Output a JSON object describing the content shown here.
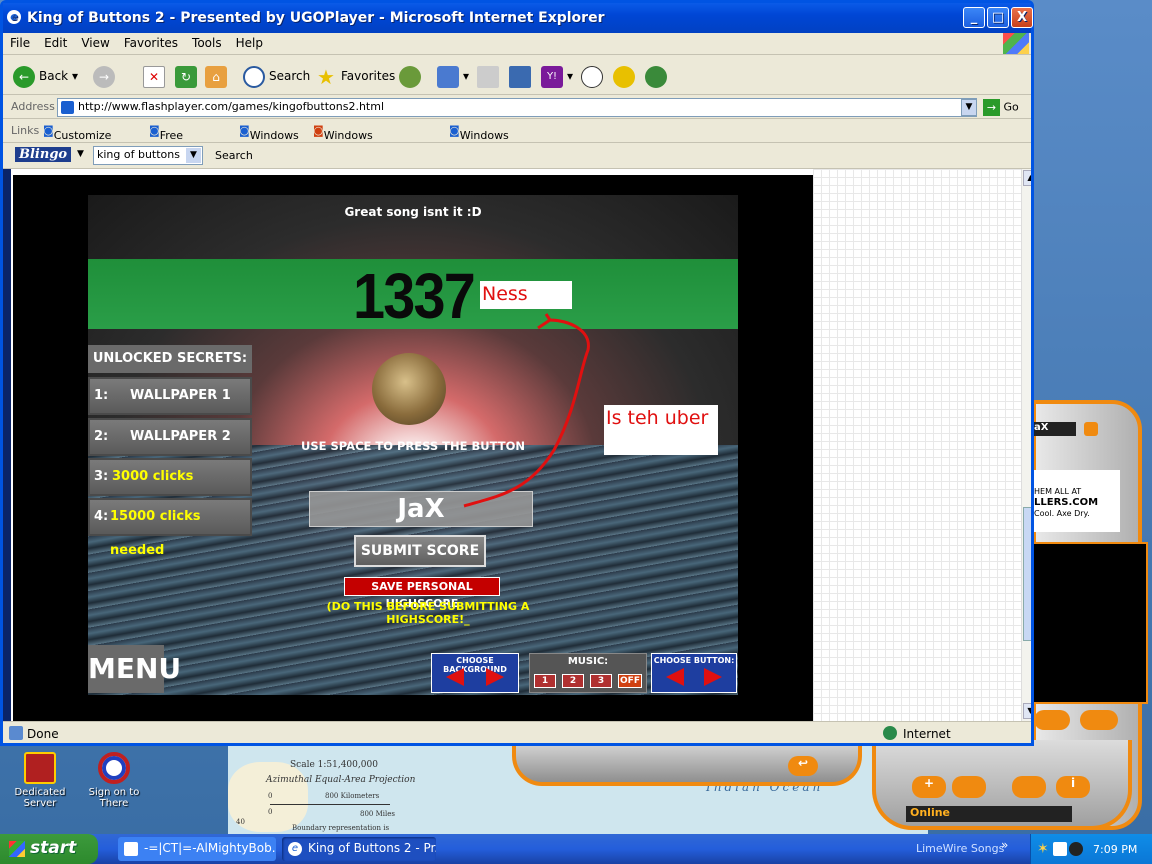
{
  "window": {
    "title": "King of Buttons 2 - Presented by UGOPlayer - Microsoft Internet Explorer",
    "minimize": "_",
    "maximize": "□",
    "close": "X"
  },
  "menubar": [
    "File",
    "Edit",
    "View",
    "Favorites",
    "Tools",
    "Help"
  ],
  "toolbar": {
    "back_label": "Back",
    "search_label": "Search",
    "favorites_label": "Favorites"
  },
  "address": {
    "label": "Address",
    "url": "http://www.flashplayer.com/games/kingofbuttons2.html",
    "go_label": "Go"
  },
  "links": {
    "label": "Links",
    "items": [
      "Customize Links",
      "Free Hotmail",
      "Windows",
      "Windows Marketplace",
      "Windows Media"
    ]
  },
  "blingo": {
    "logo": "Blingo",
    "query": "king of buttons",
    "search_label": "Search"
  },
  "game": {
    "song_line": "Great song isnt it :D",
    "score": "1337",
    "name_annotation": "Ness",
    "uber_annotation": "Is teh uber",
    "secrets_header": "UNLOCKED SECRETS:",
    "secrets": [
      {
        "num": "1:",
        "label": "WALLPAPER 1"
      },
      {
        "num": "2:",
        "label": "WALLPAPER 2"
      },
      {
        "num": "3:",
        "label": "3000 clicks needed"
      },
      {
        "num": "4:",
        "label": "15000 clicks needed"
      }
    ],
    "use_space": "USE SPACE TO PRESS THE BUTTON",
    "player_name": "JaX",
    "submit_label": "SUBMIT SCORE",
    "save_label": "SAVE PERSONAL HIGHSCORE",
    "do_this": "(DO THIS BEFORE SUBMITTING A HIGHSCORE!_",
    "menu_label": "MENU",
    "choose_background": "CHOOSE BACKGROUND",
    "music_label": "MUSIC:",
    "music_buttons": [
      "1",
      "2",
      "3",
      "OFF"
    ],
    "choose_button": "CHOOSE BUTTON:"
  },
  "statusbar": {
    "status": "Done",
    "zone": "Internet"
  },
  "desktop": {
    "icons": [
      "Dedicated Server",
      "Sign on to There"
    ],
    "map_scale": "Scale 1:51,400,000",
    "map_projection": "Azimuthal Equal-Area Projection",
    "map_km_zero": "0",
    "map_km": "800 Kilometers",
    "map_mi_zero": "0",
    "map_mi": "800 Miles",
    "map_note": "Boundary representation is",
    "map_ocean": "Indian Ocean",
    "map_lat": "40"
  },
  "messenger": {
    "name_tag": "aX",
    "ad_line1": "HEM ALL AT",
    "ad_line2": "LLERS.COM",
    "ad_line3": "Cool. Axe Dry.",
    "status": "Online"
  },
  "taskbar": {
    "start_label": "start",
    "tasks": [
      "-=|CT|=-AlMightyBob...",
      "King of Buttons 2 - Pr..."
    ],
    "tray_app": "LimeWire Songs",
    "time": "7:09 PM"
  },
  "colors": {
    "xp_blue": "#0054e3",
    "game_green": "#1f8f3a",
    "annotation_red": "#e01010",
    "secret_yellow": "#ffff00"
  }
}
